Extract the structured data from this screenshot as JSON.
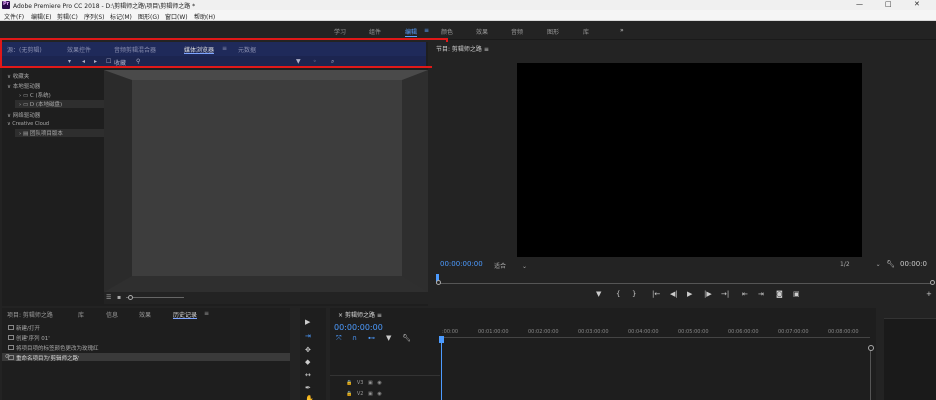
{
  "window": {
    "title": "Adobe Premiere Pro CC 2018 - D:\\剪辑师之路\\项目\\剪辑师之路 *",
    "minimize": "—",
    "maximize": "□",
    "close": "✕"
  },
  "menu": [
    "文件(F)",
    "编辑(E)",
    "剪辑(C)",
    "序列(S)",
    "标记(M)",
    "图形(G)",
    "窗口(W)",
    "帮助(H)"
  ],
  "workspaces": {
    "items": [
      "学习",
      "组件",
      "编辑",
      "颜色",
      "效果",
      "音频",
      "图形",
      "库"
    ],
    "active": "编辑",
    "more": "»",
    "menu_icon": "≡"
  },
  "source_panel": {
    "tabs": [
      "源：(无剪辑)",
      "效果控件",
      "音频剪辑混合器",
      "媒体浏览器",
      "元数据"
    ],
    "active_tab": "媒体浏览器",
    "tab_menu": "≡",
    "toolbar": {
      "favorite_label": "收藏",
      "checkbox": "☐"
    },
    "tree": [
      {
        "label": "收藏夹",
        "level": 0,
        "arrow": "∨"
      },
      {
        "label": "本地驱动器",
        "level": 0,
        "arrow": "∨"
      },
      {
        "label": "C (系统)",
        "level": 1,
        "arrow": "›"
      },
      {
        "label": "D (本地磁盘)",
        "level": 1,
        "arrow": "›"
      },
      {
        "label": "网络驱动器",
        "level": 0,
        "arrow": "∨"
      },
      {
        "label": "Creative Cloud",
        "level": 0,
        "arrow": "∨"
      },
      {
        "label": "团队项目版本",
        "level": 1,
        "arrow": "›"
      }
    ]
  },
  "program_monitor": {
    "tab": "节目: 剪辑师之路",
    "tab_menu": "≡",
    "timecode": "00:00:00:00",
    "fit": "适合",
    "resolution": "1/2",
    "duration": "00:00:0",
    "controls": [
      "▼",
      "{",
      "}",
      "|←",
      "◀|",
      "▶",
      "|▶",
      "→|",
      "⇤",
      "⇥",
      "◙",
      "▣"
    ]
  },
  "history_panel": {
    "tabs": [
      "项目: 剪辑师之路",
      "库",
      "信息",
      "效果",
      "历史记录"
    ],
    "active_tab": "历史记录",
    "tab_menu": "≡",
    "items": [
      "新建/打开",
      "创建'序列 01'",
      "将项目项的标签颜色更改为玫瑰红",
      "重命名项目为'剪辑师之路'"
    ],
    "selected_index": 3
  },
  "timeline": {
    "tab_close": "×",
    "sequence_name": "剪辑师之路",
    "tab_menu": "≡",
    "timecode": "00:00:00:00",
    "ruler": [
      ":00:00",
      "00:01:00:00",
      "00:02:00:00",
      "00:03:00:00",
      "00:04:00:00",
      "00:05:00:00",
      "00:06:00:00",
      "00:07:00:00",
      "00:08:00:00"
    ],
    "tracks": [
      {
        "lock": "🔒",
        "name": "V3",
        "toggle": "▣",
        "eye": "◉"
      },
      {
        "lock": "🔒",
        "name": "V2",
        "toggle": "▣",
        "eye": "◉"
      }
    ]
  },
  "tools": [
    "▶",
    "⇥",
    "✥",
    "◆",
    "↔",
    "✒",
    "✋"
  ],
  "colors": {
    "accent": "#4c9bff",
    "highlight_box": "#e01818",
    "panel_tab_bg": "#1f2a5a",
    "app_bg": "#232323"
  }
}
